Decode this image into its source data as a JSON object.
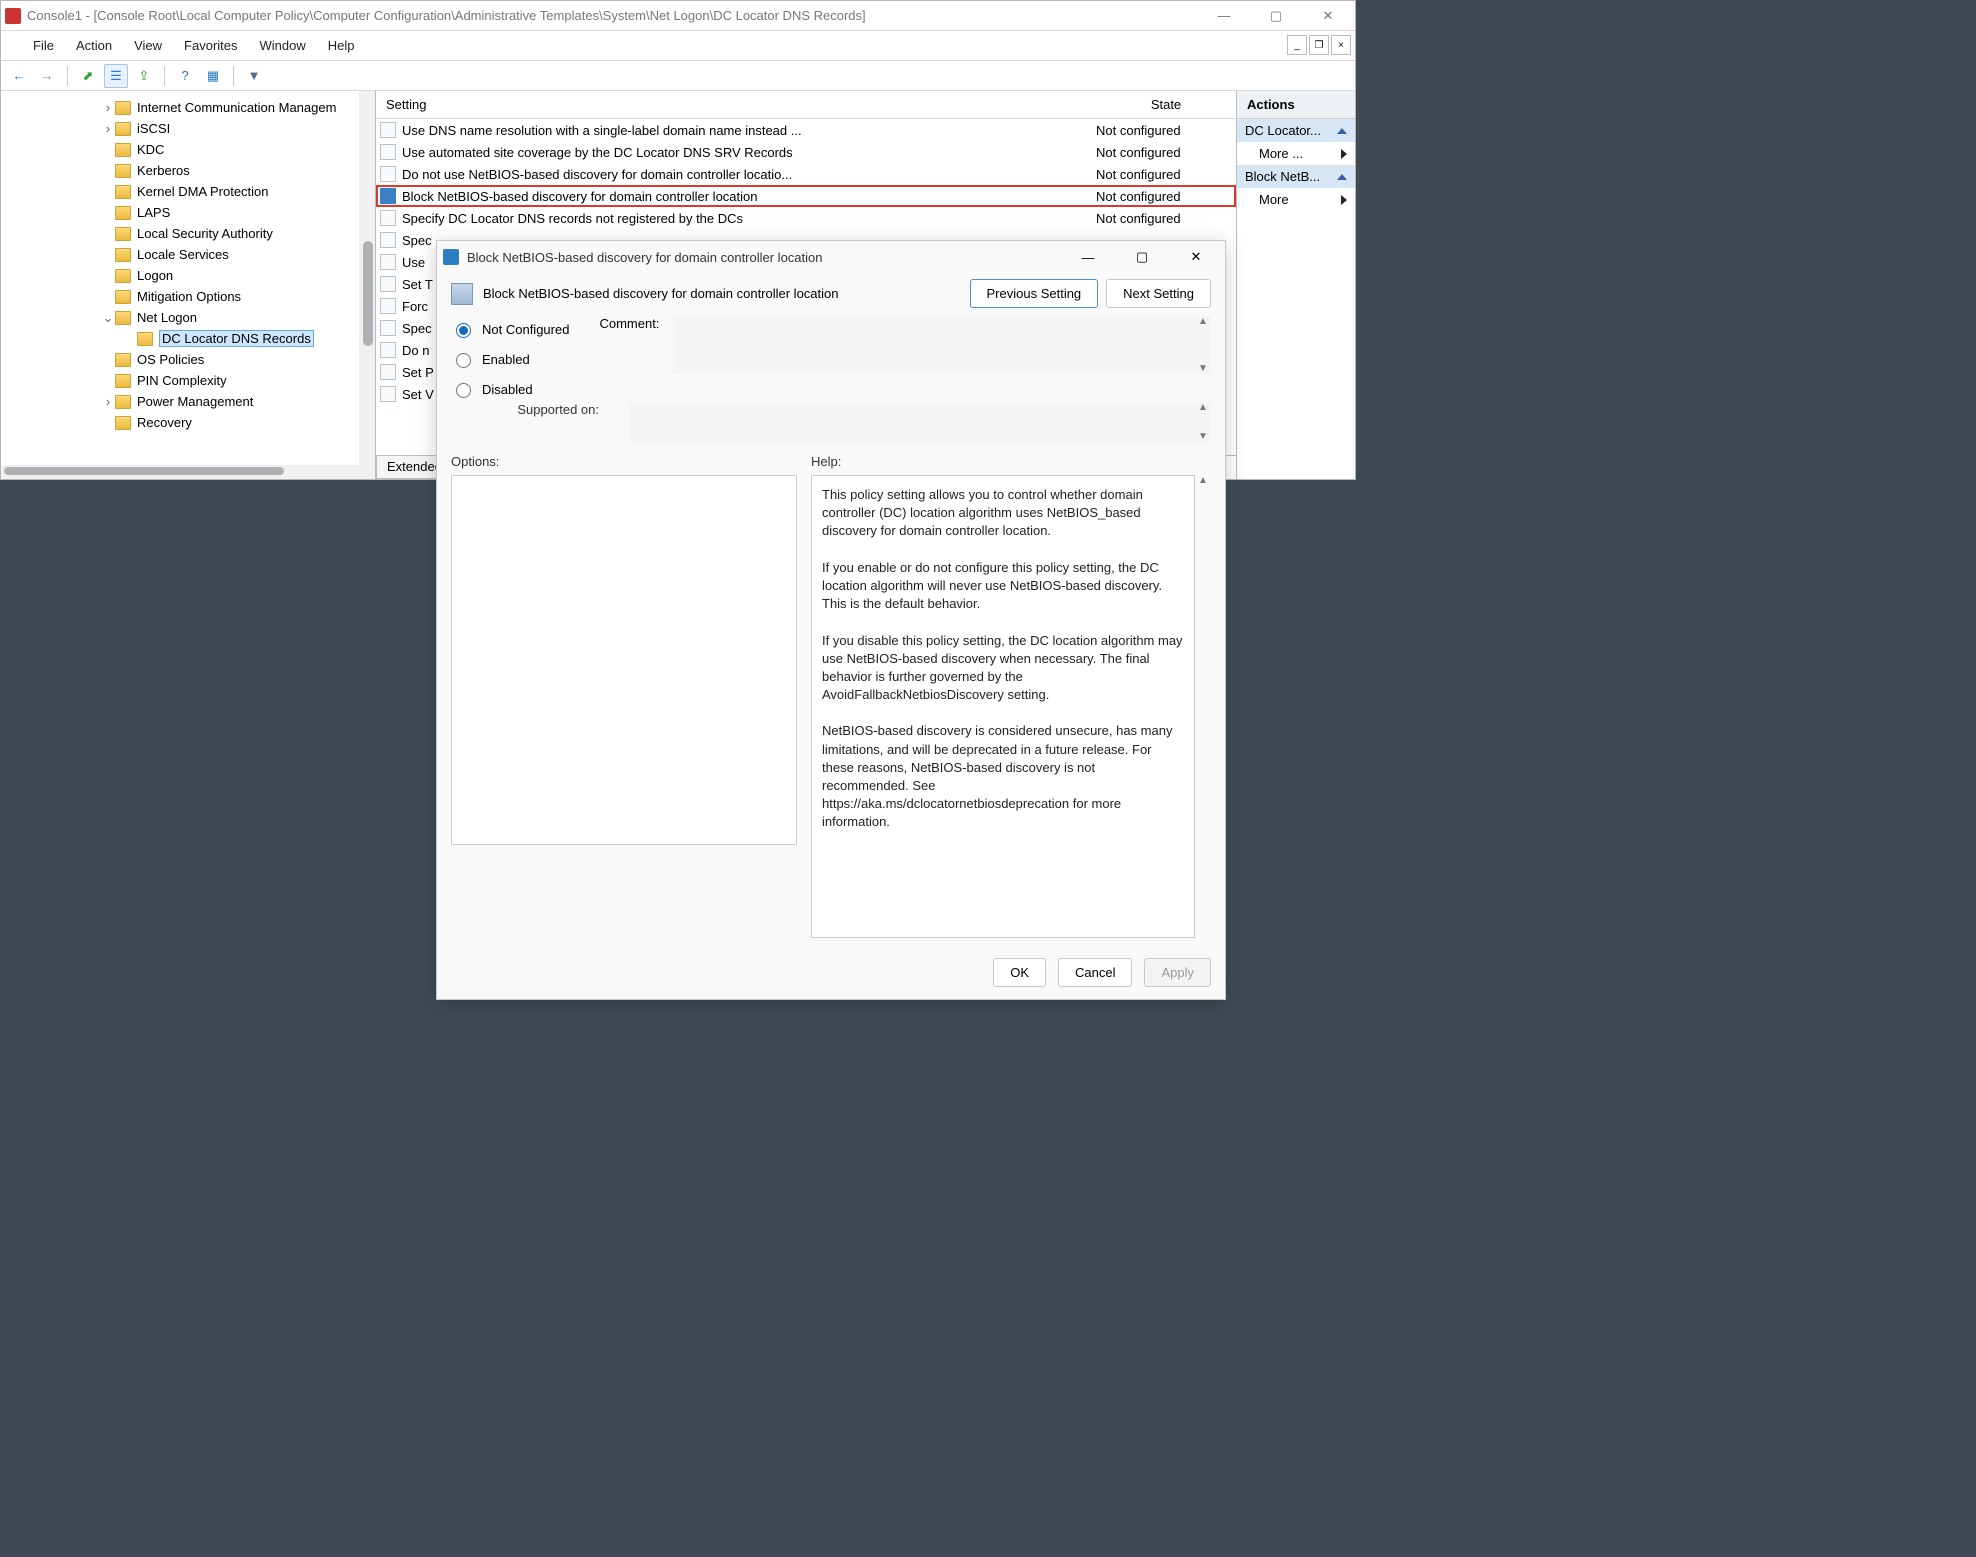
{
  "window": {
    "title": "Console1 - [Console Root\\Local Computer Policy\\Computer Configuration\\Administrative Templates\\System\\Net Logon\\DC Locator DNS Records]",
    "minimize": "—",
    "maximize": "▢",
    "close": "✕"
  },
  "menubar": [
    "File",
    "Action",
    "View",
    "Favorites",
    "Window",
    "Help"
  ],
  "childctrls": {
    "min": "_",
    "restore": "❐",
    "close": "×"
  },
  "toolbar": {
    "back": "←",
    "fwd": "→",
    "up": "⬈",
    "list": "☰",
    "export": "⇪",
    "help": "?",
    "view": "▦",
    "filter": "▼"
  },
  "tree": [
    {
      "indent": 100,
      "exp": ">",
      "label": "Internet Communication Managem"
    },
    {
      "indent": 100,
      "exp": ">",
      "label": "iSCSI"
    },
    {
      "indent": 100,
      "exp": "",
      "label": "KDC"
    },
    {
      "indent": 100,
      "exp": "",
      "label": "Kerberos"
    },
    {
      "indent": 100,
      "exp": "",
      "label": "Kernel DMA Protection"
    },
    {
      "indent": 100,
      "exp": "",
      "label": "LAPS"
    },
    {
      "indent": 100,
      "exp": "",
      "label": "Local Security Authority"
    },
    {
      "indent": 100,
      "exp": "",
      "label": "Locale Services"
    },
    {
      "indent": 100,
      "exp": "",
      "label": "Logon"
    },
    {
      "indent": 100,
      "exp": "",
      "label": "Mitigation Options"
    },
    {
      "indent": 100,
      "exp": "v",
      "label": "Net Logon"
    },
    {
      "indent": 122,
      "exp": "",
      "label": "DC Locator DNS Records",
      "sel": true
    },
    {
      "indent": 100,
      "exp": "",
      "label": "OS Policies"
    },
    {
      "indent": 100,
      "exp": "",
      "label": "PIN Complexity"
    },
    {
      "indent": 100,
      "exp": ">",
      "label": "Power Management"
    },
    {
      "indent": 100,
      "exp": "",
      "label": "Recovery"
    }
  ],
  "list": {
    "col_setting": "Setting",
    "col_state": "State",
    "rows": [
      {
        "t": "Use DNS name resolution with a single-label domain name instead ...",
        "s": "Not configured"
      },
      {
        "t": "Use automated site coverage by the DC Locator DNS SRV Records",
        "s": "Not configured"
      },
      {
        "t": "Do not use NetBIOS-based discovery for domain controller locatio...",
        "s": "Not configured"
      },
      {
        "t": "Block NetBIOS-based discovery for domain controller location",
        "s": "Not configured",
        "hl": true
      },
      {
        "t": "Specify DC Locator DNS records not registered by the DCs",
        "s": "Not configured"
      },
      {
        "t": "Spec",
        "s": ""
      },
      {
        "t": "Use",
        "s": ""
      },
      {
        "t": "Set T",
        "s": ""
      },
      {
        "t": "Forc",
        "s": ""
      },
      {
        "t": "Spec",
        "s": ""
      },
      {
        "t": "Do n",
        "s": ""
      },
      {
        "t": "Set P",
        "s": ""
      },
      {
        "t": "Set V",
        "s": ""
      }
    ],
    "tab_ext": "Extended"
  },
  "actions": {
    "header": "Actions",
    "g1": "DC Locator...",
    "more": "More ...",
    "g2": "Block NetB...",
    "more2": "More"
  },
  "dialog": {
    "title": "Block NetBIOS-based discovery for domain controller location",
    "heading": "Block NetBIOS-based discovery for domain controller location",
    "prev": "Previous Setting",
    "next": "Next Setting",
    "r_nc": "Not Configured",
    "r_en": "Enabled",
    "r_dis": "Disabled",
    "lbl_comment": "Comment:",
    "lbl_supported": "Supported on:",
    "lbl_options": "Options:",
    "lbl_help": "Help:",
    "help_text": "This policy setting allows you to control whether domain controller (DC) location algorithm uses NetBIOS_based discovery for domain controller location.\n\nIf you enable or do not configure this policy setting, the DC location algorithm will never use NetBIOS-based discovery. This is the default behavior.\n\nIf you disable this policy setting, the DC location algorithm may use NetBIOS-based discovery when necessary. The final behavior is further governed by the AvoidFallbackNetbiosDiscovery setting.\n\nNetBIOS-based discovery is considered unsecure, has many limitations, and will be deprecated in a future release. For these reasons, NetBIOS-based discovery is not recommended. See https://aka.ms/dclocatornetbiosdeprecation for more information.",
    "ok": "OK",
    "cancel": "Cancel",
    "apply": "Apply",
    "min": "—",
    "max": "▢",
    "close": "✕"
  }
}
